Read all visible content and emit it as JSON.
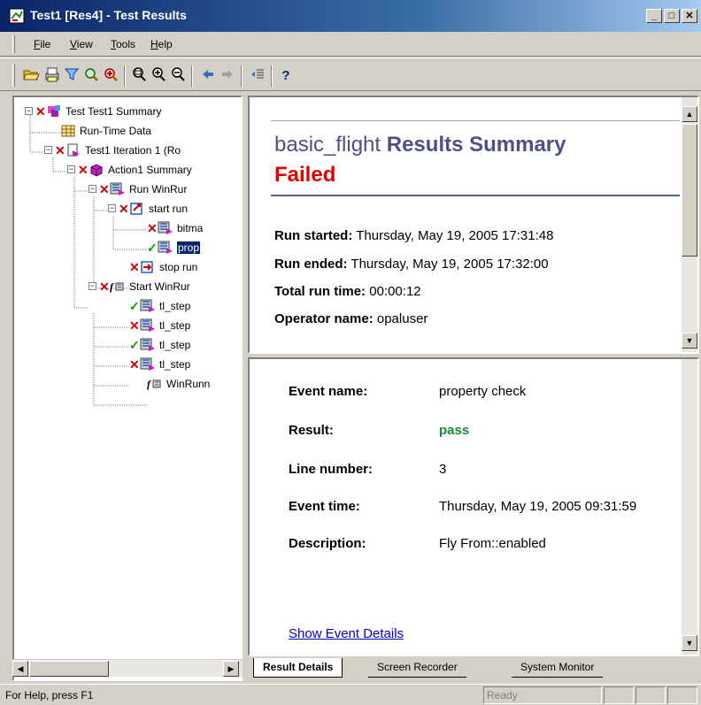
{
  "window": {
    "title": "Test1 [Res4] - Test Results"
  },
  "menu": {
    "items": [
      {
        "label": "File",
        "accel": "F"
      },
      {
        "label": "View",
        "accel": "V"
      },
      {
        "label": "Tools",
        "accel": "T"
      },
      {
        "label": "Help",
        "accel": "H"
      }
    ]
  },
  "toolbar": {
    "buttons": [
      "open-icon",
      "print-icon",
      "filter-icon",
      "find-icon",
      "jump-icon",
      "zoom-fit-icon",
      "zoom-in-icon",
      "zoom-out-icon",
      "back-icon",
      "forward-icon",
      "expand-icon",
      "help-icon"
    ]
  },
  "tree": {
    "nodes": [
      {
        "label": "Test Test1 Summary",
        "status": "fail",
        "icon": "summary-icon",
        "expander": "−"
      },
      {
        "label": "Run-Time Data",
        "status": "",
        "icon": "table-icon",
        "expander": ""
      },
      {
        "label": "Test1 Iteration 1 (Ro",
        "status": "fail",
        "icon": "iteration-icon",
        "expander": "−"
      },
      {
        "label": "Action1 Summary",
        "status": "fail",
        "icon": "action-icon",
        "expander": "−"
      },
      {
        "label": "Run WinRur",
        "status": "fail",
        "icon": "winrunner-icon",
        "expander": "−"
      },
      {
        "label": "start run",
        "status": "fail",
        "icon": "start-run-icon",
        "expander": "−"
      },
      {
        "label": "bitma",
        "status": "fail",
        "icon": "winrunner-icon",
        "expander": ""
      },
      {
        "label": "prop",
        "status": "pass",
        "icon": "winrunner-icon",
        "expander": "",
        "selected": true
      },
      {
        "label": "stop run",
        "status": "fail",
        "icon": "stop-run-icon",
        "expander": ""
      },
      {
        "label": "Start WinRur",
        "status": "fail",
        "icon": "function-icon",
        "expander": "−"
      },
      {
        "label": "tl_step",
        "status": "pass",
        "icon": "winrunner-icon",
        "expander": ""
      },
      {
        "label": "tl_step",
        "status": "fail",
        "icon": "winrunner-icon",
        "expander": ""
      },
      {
        "label": "tl_step",
        "status": "pass",
        "icon": "winrunner-icon",
        "expander": ""
      },
      {
        "label": "tl_step",
        "status": "fail",
        "icon": "winrunner-icon",
        "expander": ""
      },
      {
        "label": "WinRunn",
        "status": "",
        "icon": "function-icon",
        "expander": ""
      }
    ]
  },
  "summary": {
    "test_name": "basic_flight",
    "title_suffix": "Results Summary",
    "status": "Failed",
    "fields": [
      {
        "key": "Run started:",
        "value": "Thursday, May 19, 2005 17:31:48"
      },
      {
        "key": "Run ended:",
        "value": "Thursday, May 19, 2005 17:32:00"
      },
      {
        "key": "Total run time:",
        "value": "00:00:12"
      },
      {
        "key": "Operator name:",
        "value": "opaluser"
      }
    ]
  },
  "details": {
    "fields": [
      {
        "key": "Event name:",
        "value": "property check",
        "style": ""
      },
      {
        "key": "Result:",
        "value": "pass",
        "style": "pass"
      },
      {
        "key": "Line number:",
        "value": "3",
        "style": ""
      },
      {
        "key": "Event time:",
        "value": "Thursday, May 19, 2005 09:31:59",
        "style": ""
      },
      {
        "key": "Description:",
        "value": "Fly From::enabled",
        "style": ""
      }
    ],
    "link": "Show Event Details"
  },
  "tabs": [
    {
      "label": "Result Details",
      "active": true
    },
    {
      "label": "Screen Recorder",
      "active": false
    },
    {
      "label": "System Monitor",
      "active": false
    }
  ],
  "statusbar": {
    "help_text": "For Help, press F1",
    "state": "Ready"
  },
  "colors": {
    "fail": "#d00000",
    "pass": "#00a000",
    "summary_title": "#4d5087",
    "link": "#0000cc",
    "selection": "#0a246a"
  }
}
